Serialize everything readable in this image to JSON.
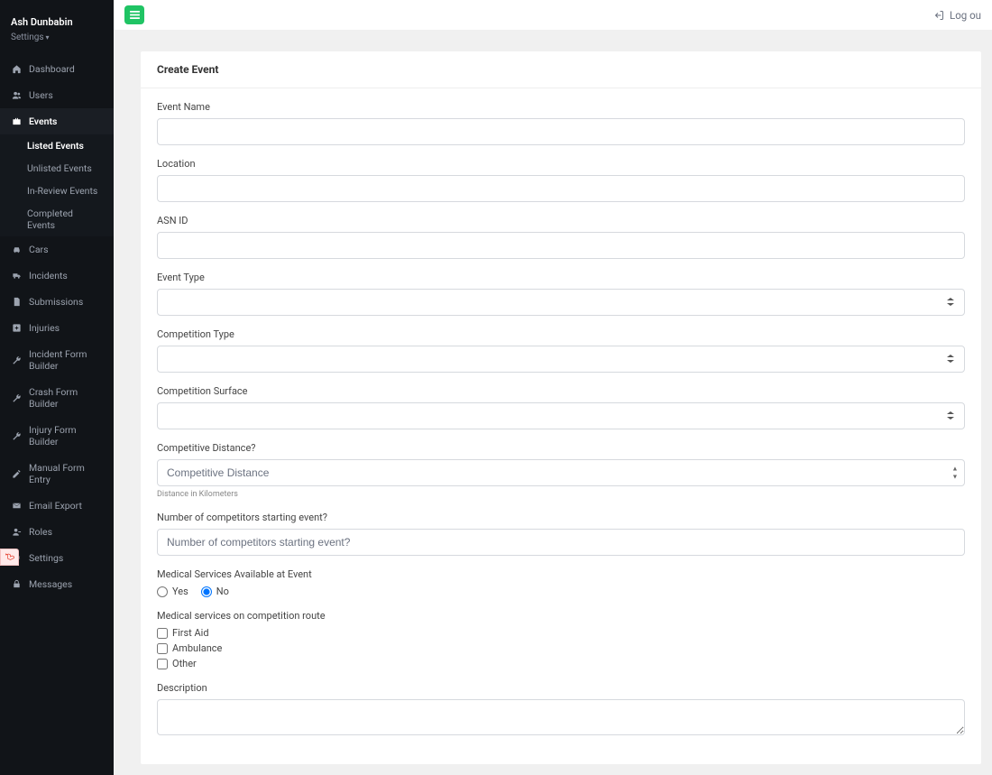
{
  "user": {
    "name": "Ash Dunbabin",
    "settings_label": "Settings"
  },
  "nav": {
    "items": [
      {
        "label": "Dashboard"
      },
      {
        "label": "Users"
      },
      {
        "label": "Events"
      },
      {
        "label": "Cars"
      },
      {
        "label": "Incidents"
      },
      {
        "label": "Submissions"
      },
      {
        "label": "Injuries"
      },
      {
        "label": "Incident Form Builder"
      },
      {
        "label": "Crash Form Builder"
      },
      {
        "label": "Injury Form Builder"
      },
      {
        "label": "Manual Form Entry"
      },
      {
        "label": "Email Export"
      },
      {
        "label": "Roles"
      },
      {
        "label": "Settings"
      },
      {
        "label": "Messages"
      }
    ],
    "events_sub": [
      {
        "label": "Listed Events"
      },
      {
        "label": "Unlisted Events"
      },
      {
        "label": "In-Review Events"
      },
      {
        "label": "Completed Events"
      }
    ]
  },
  "topbar": {
    "logout_label": "Log ou"
  },
  "form": {
    "title": "Create Event",
    "fields": {
      "event_name": {
        "label": "Event Name"
      },
      "location": {
        "label": "Location"
      },
      "asn_id": {
        "label": "ASN ID"
      },
      "event_type": {
        "label": "Event Type"
      },
      "competition_type": {
        "label": "Competition Type"
      },
      "competition_surface": {
        "label": "Competition Surface"
      },
      "competitive_distance": {
        "label": "Competitive Distance?",
        "placeholder": "Competitive Distance",
        "help": "Distance in Kilometers"
      },
      "num_competitors": {
        "label": "Number of competitors starting event?",
        "placeholder": "Number of competitors starting event?"
      },
      "medical_available": {
        "label": "Medical Services Available at Event",
        "yes": "Yes",
        "no": "No"
      },
      "medical_route": {
        "label": "Medical services on competition route",
        "first_aid": "First Aid",
        "ambulance": "Ambulance",
        "other": "Other"
      },
      "description": {
        "label": "Description"
      }
    }
  }
}
